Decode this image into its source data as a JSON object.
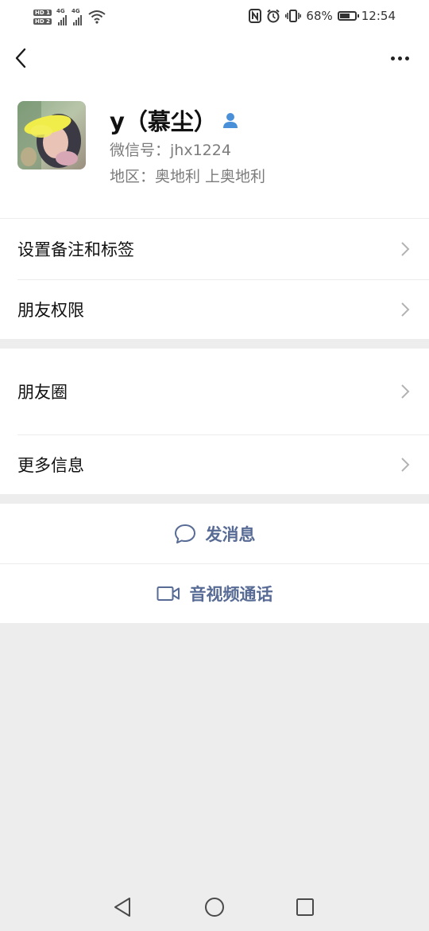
{
  "status_bar": {
    "sim1": "HD 1",
    "sim2": "HD 2",
    "net1": "4G",
    "net2": "4G",
    "battery_percent": "68%",
    "battery_level": 0.68,
    "time": "12:54"
  },
  "profile": {
    "name": "y（慕尘）",
    "wechat_id": "微信号：jhx1224",
    "region": "地区：奥地利 上奥地利"
  },
  "menu": {
    "remark_tags": "设置备注和标签",
    "friend_permissions": "朋友权限",
    "moments": "朋友圈",
    "more_info": "更多信息"
  },
  "actions": {
    "send_message": "发消息",
    "video_call": "音视频通话",
    "accent_color": "#576b95"
  },
  "icons": {
    "back": "chevron-left-icon",
    "more": "more-dots-icon",
    "friend": "person-icon",
    "message": "speech-bubble-icon",
    "video": "video-camera-icon"
  }
}
